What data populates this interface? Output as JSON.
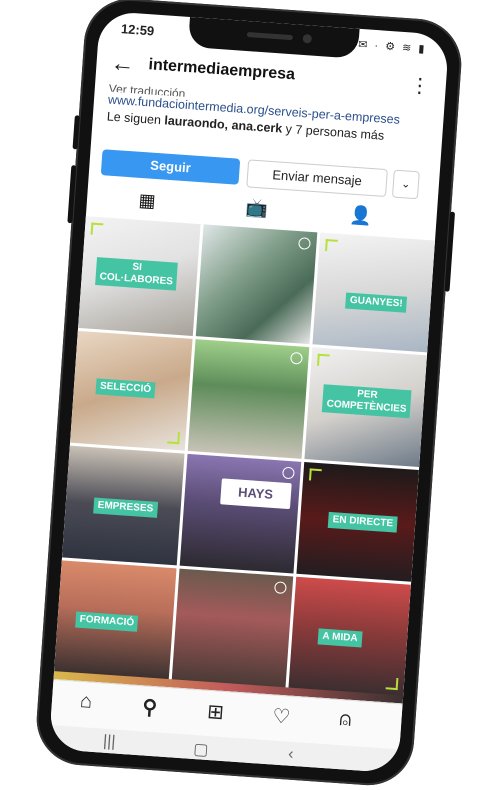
{
  "status": {
    "time": "12:59",
    "icons": "▮ ✉ ·  ⚙ ≋ ▮"
  },
  "topbar": {
    "username": "intermediaempresa"
  },
  "bio": {
    "cut_line": "Ver traducción",
    "link": "www.fundaciointermedia.org/serveis-per-a-empreses",
    "followed_prefix": "Le siguen ",
    "followed_names": "lauraondo, ana.cerk",
    "followed_suffix": " y 7 personas más"
  },
  "actions": {
    "follow": "Seguir",
    "message": "Enviar mensaje"
  },
  "grid": [
    {
      "label": "SI\nCOL·LABORES"
    },
    {
      "label": ""
    },
    {
      "label": "GUANYES!"
    },
    {
      "label": "SELECCIÓ"
    },
    {
      "label": ""
    },
    {
      "label": "PER\nCOMPETÈNCIES"
    },
    {
      "label": "EMPRESES"
    },
    {
      "label": "",
      "sign": "HAYS"
    },
    {
      "label": "EN DIRECTE"
    },
    {
      "label": "FORMACIÓ"
    },
    {
      "label": ""
    },
    {
      "label": "A MIDA"
    }
  ],
  "colors": {
    "accent": "#3897f0",
    "label_bg": "#45c4a4",
    "corner": "#b6e13a"
  },
  "icons": {
    "grid": "grid-icon",
    "igtv": "igtv-icon",
    "tagged": "tagged-icon",
    "home": "home-icon",
    "search": "search-icon",
    "add": "add-icon",
    "heart": "heart-icon",
    "profile": "profile-icon"
  }
}
